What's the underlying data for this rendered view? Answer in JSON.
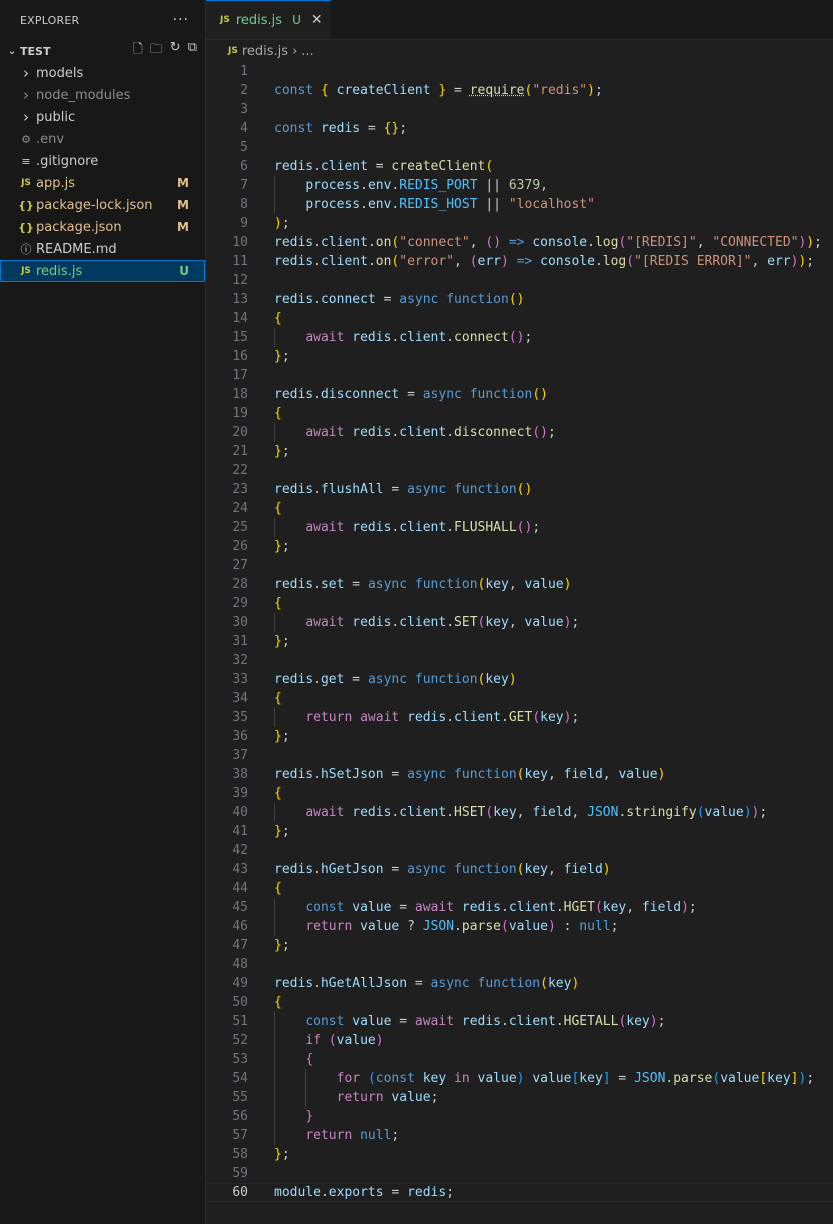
{
  "explorer": {
    "title": "EXPLORER",
    "more": "···",
    "folder": "TEST",
    "items": [
      {
        "label": "models",
        "kind": "folder",
        "badge": ""
      },
      {
        "label": "node_modules",
        "kind": "folder-dim",
        "badge": ""
      },
      {
        "label": "public",
        "kind": "folder",
        "badge": ""
      },
      {
        "label": ".env",
        "kind": "gear",
        "badge": ""
      },
      {
        "label": ".gitignore",
        "kind": "lines",
        "badge": ""
      },
      {
        "label": "app.js",
        "kind": "js",
        "badge": "M"
      },
      {
        "label": "package-lock.json",
        "kind": "json",
        "badge": "M"
      },
      {
        "label": "package.json",
        "kind": "json",
        "badge": "M"
      },
      {
        "label": "README.md",
        "kind": "info",
        "badge": ""
      },
      {
        "label": "redis.js",
        "kind": "js",
        "badge": "U"
      }
    ]
  },
  "icons": {
    "js": "JS",
    "json": "{}",
    "chevron": "›",
    "close": "✕"
  },
  "tab": {
    "label": "redis.js",
    "badge": "U"
  },
  "breadcrumb": {
    "file": "redis.js",
    "sep": "›",
    "rest": "..."
  },
  "editor": {
    "lines": [
      "",
      "const { createClient } = require(\"redis\");",
      "",
      "const redis = {};",
      "",
      "redis.client = createClient(",
      "    process.env.REDIS_PORT || 6379,",
      "    process.env.REDIS_HOST || \"localhost\"",
      ");",
      "redis.client.on(\"connect\", () => console.log(\"[REDIS]\", \"CONNECTED\"));",
      "redis.client.on(\"error\", (err) => console.log(\"[REDIS ERROR]\", err));",
      "",
      "redis.connect = async function()",
      "{",
      "    await redis.client.connect();",
      "};",
      "",
      "redis.disconnect = async function()",
      "{",
      "    await redis.client.disconnect();",
      "};",
      "",
      "redis.flushAll = async function()",
      "{",
      "    await redis.client.FLUSHALL();",
      "};",
      "",
      "redis.set = async function(key, value)",
      "{",
      "    await redis.client.SET(key, value);",
      "};",
      "",
      "redis.get = async function(key)",
      "{",
      "    return await redis.client.GET(key);",
      "};",
      "",
      "redis.hSetJson = async function(key, field, value)",
      "{",
      "    await redis.client.HSET(key, field, JSON.stringify(value));",
      "};",
      "",
      "redis.hGetJson = async function(key, field)",
      "{",
      "    const value = await redis.client.HGET(key, field);",
      "    return value ? JSON.parse(value) : null;",
      "};",
      "",
      "redis.hGetAllJson = async function(key)",
      "{",
      "    const value = await redis.client.HGETALL(key);",
      "    if (value)",
      "    {",
      "        for (const key in value) value[key] = JSON.parse(value[key]);",
      "        return value;",
      "    }",
      "    return null;",
      "};",
      "",
      "module.exports = redis;"
    ],
    "current_line": 60
  }
}
